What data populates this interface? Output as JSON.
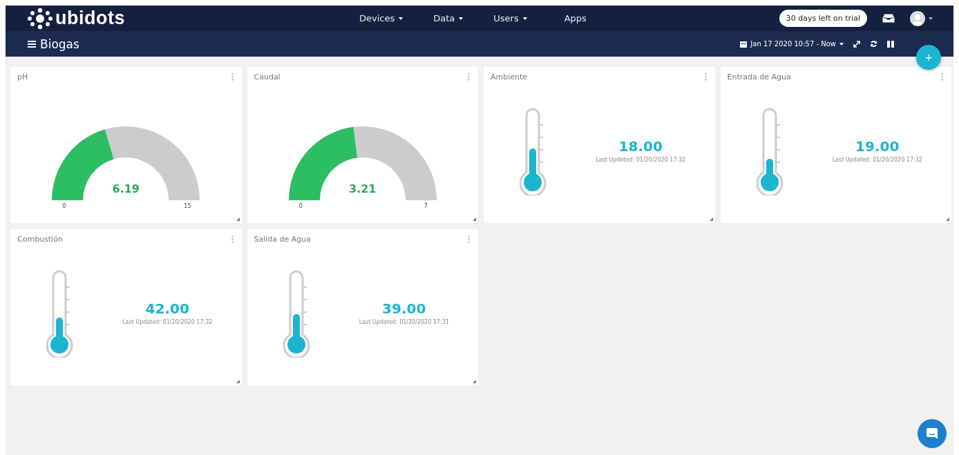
{
  "brand": {
    "name": "ubidots"
  },
  "nav": [
    {
      "label": "Devices",
      "dropdown": true
    },
    {
      "label": "Data",
      "dropdown": true
    },
    {
      "label": "Users",
      "dropdown": true
    },
    {
      "label": "Apps",
      "dropdown": false
    }
  ],
  "trial_badge": "30 days left on trial",
  "dashboard": {
    "title": "Biogas",
    "date_range": "Jan 17 2020 10:57 - Now"
  },
  "add_button": "+",
  "widgets": [
    {
      "kind": "gauge",
      "title": "pH",
      "value": "6.19",
      "min": "0",
      "max": "15",
      "level": 0.41
    },
    {
      "kind": "gauge",
      "title": "Caudal",
      "value": "3.21",
      "min": "0",
      "max": "7",
      "level": 0.46
    },
    {
      "kind": "thermometer",
      "title": "Ambiente",
      "value": "18.00",
      "updated": "Last Updated: 01/20/2020 17:32",
      "level": 0.5
    },
    {
      "kind": "thermometer",
      "title": "Entrada de Agua",
      "value": "19.00",
      "updated": "Last Updated: 01/20/2020 17:32",
      "level": 0.35
    },
    {
      "kind": "thermometer",
      "title": "Combustión",
      "value": "42.00",
      "updated": "Last Updated: 01/20/2020 17:32",
      "level": 0.4
    },
    {
      "kind": "thermometer",
      "title": "Salida de Agua",
      "value": "39.00",
      "updated": "Last Updated: 01/20/2020 17:31",
      "level": 0.45
    }
  ]
}
